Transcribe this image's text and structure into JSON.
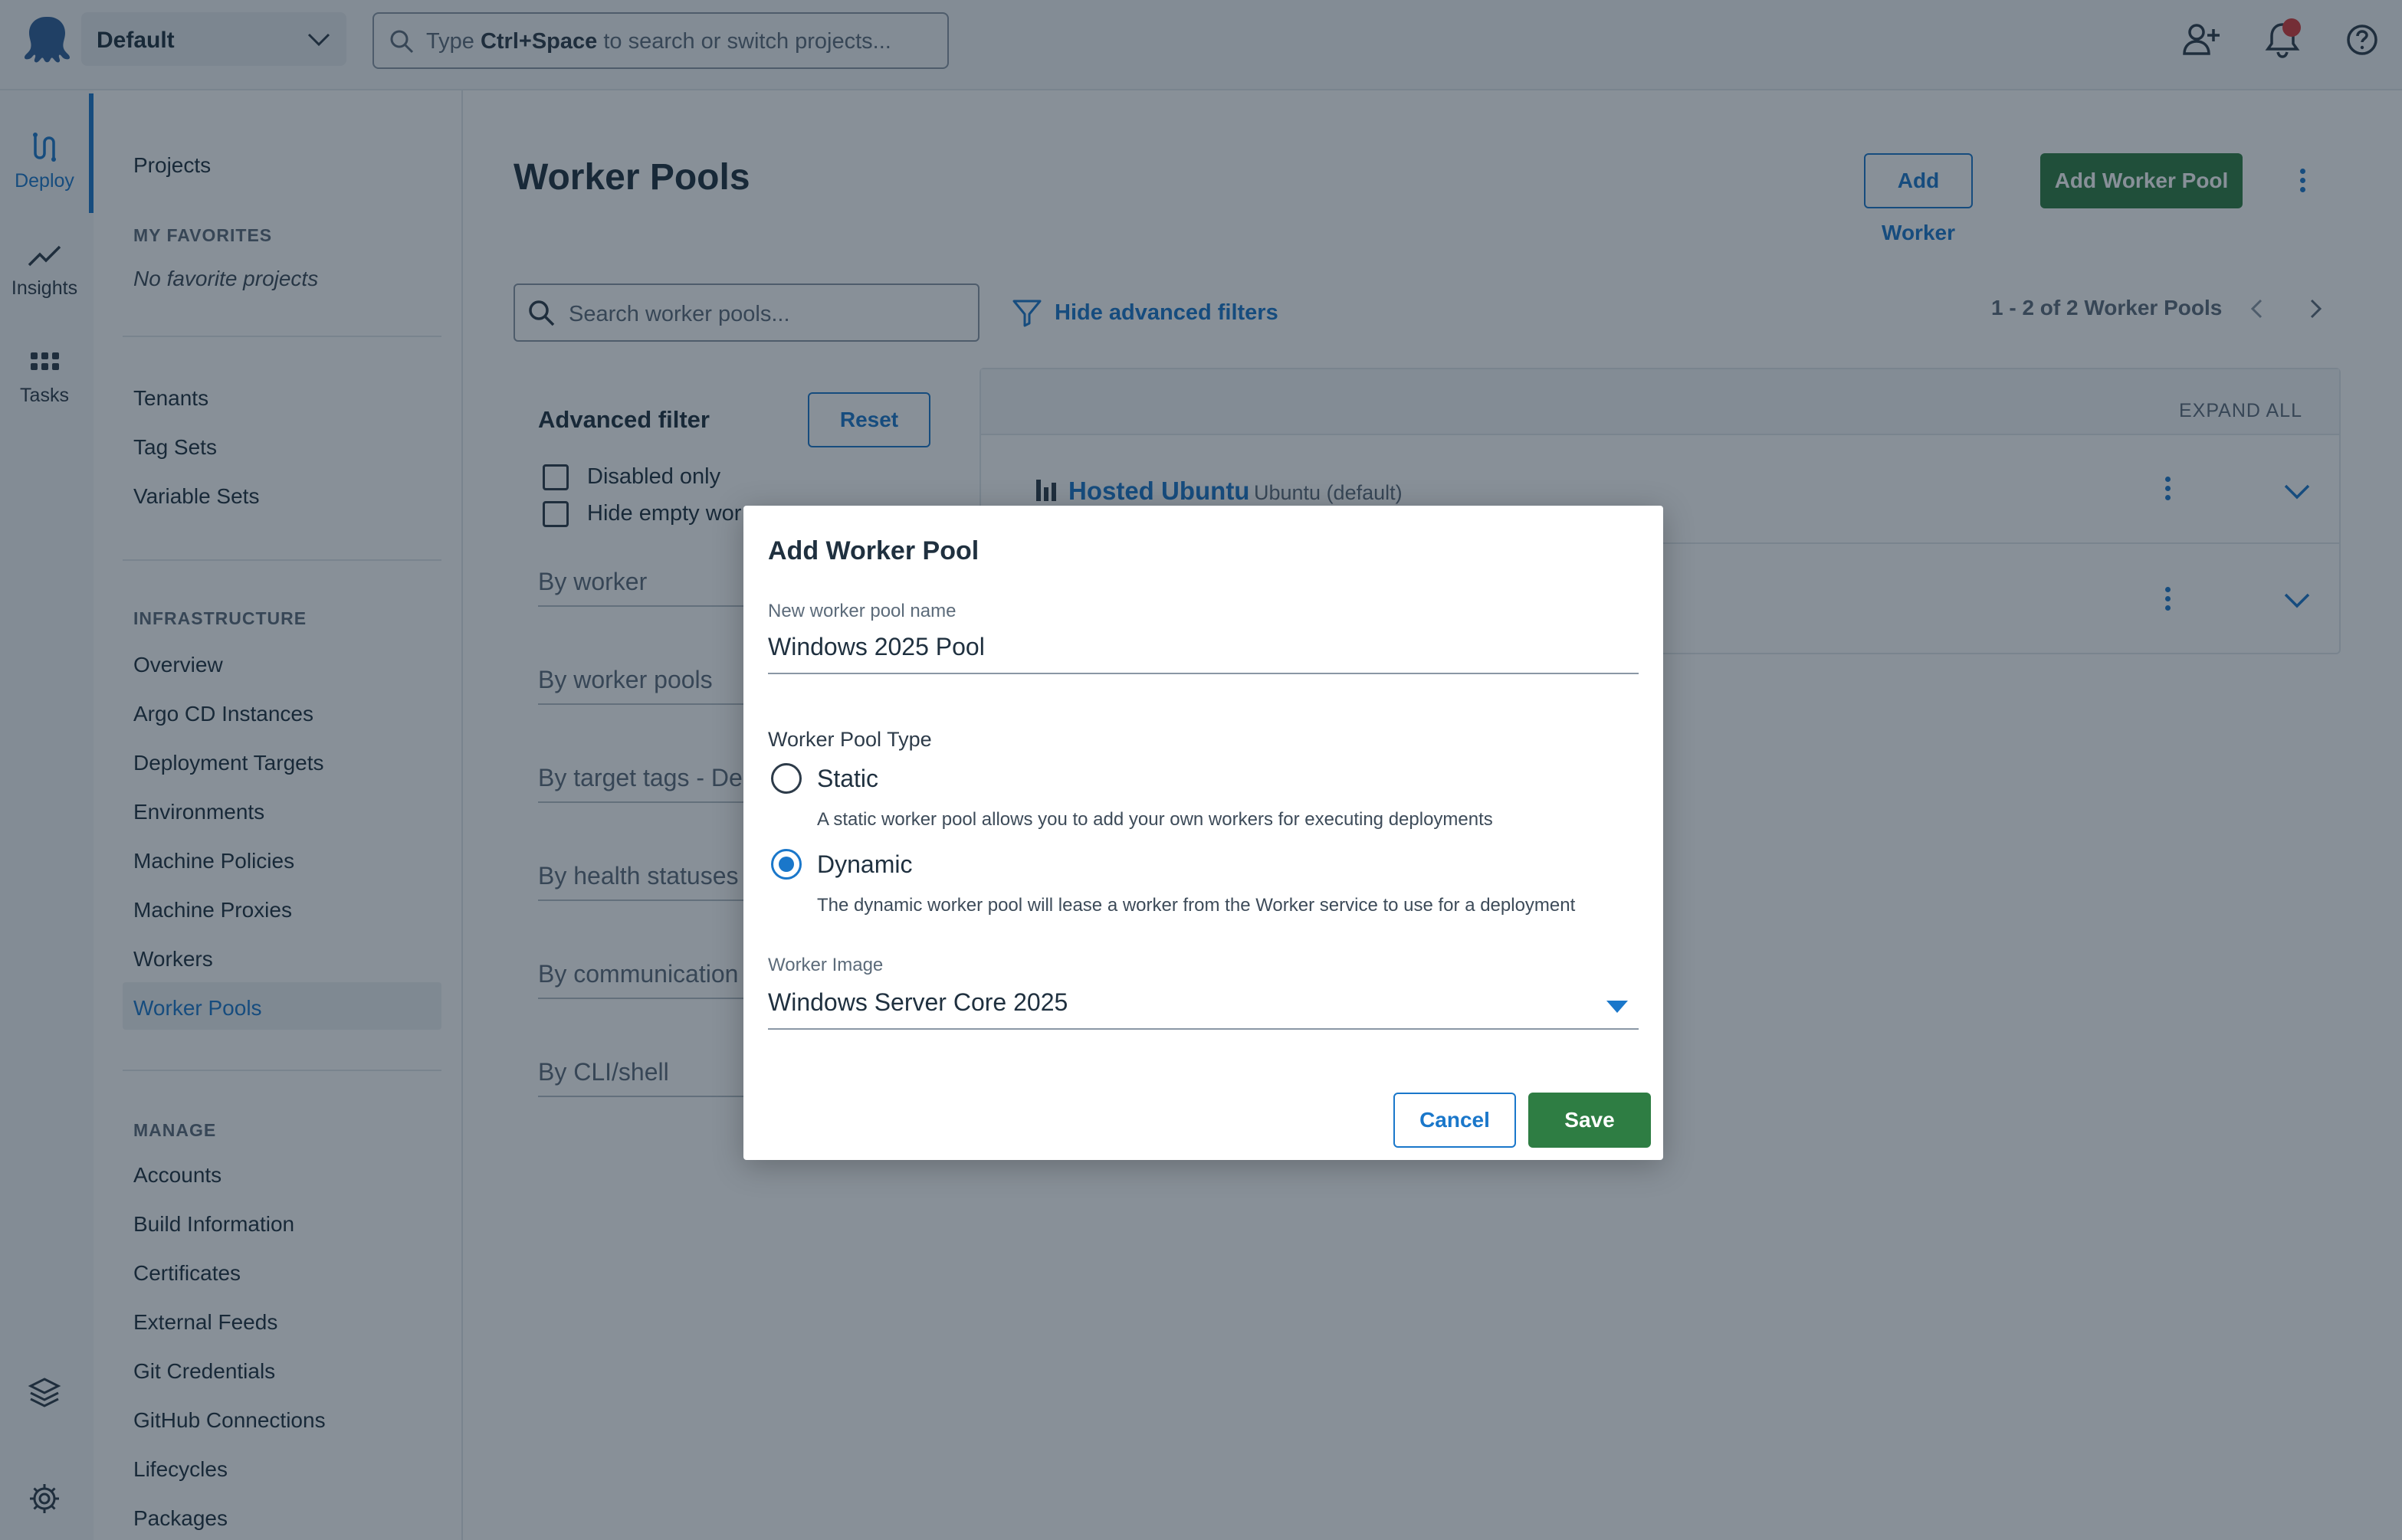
{
  "topbar": {
    "space_name": "Default",
    "search_placeholder_pre": "Type ",
    "search_placeholder_key": "Ctrl+Space",
    "search_placeholder_post": " to search or switch projects..."
  },
  "rail": {
    "items": [
      {
        "label": "Deploy",
        "icon": "deploy-icon"
      },
      {
        "label": "Insights",
        "icon": "insights-icon"
      },
      {
        "label": "Tasks",
        "icon": "tasks-icon"
      }
    ],
    "bottom_icons": [
      "layers-icon",
      "gear-icon"
    ]
  },
  "sidebar": {
    "projects": "Projects",
    "favorites_heading": "MY FAVORITES",
    "favorites_empty": "No favorite projects",
    "group1": [
      "Tenants",
      "Tag Sets",
      "Variable Sets"
    ],
    "infrastructure_heading": "INFRASTRUCTURE",
    "infrastructure": [
      "Overview",
      "Argo CD Instances",
      "Deployment Targets",
      "Environments",
      "Machine Policies",
      "Machine Proxies",
      "Workers",
      "Worker Pools"
    ],
    "manage_heading": "MANAGE",
    "manage": [
      "Accounts",
      "Build Information",
      "Certificates",
      "External Feeds",
      "Git Credentials",
      "GitHub Connections",
      "Lifecycles",
      "Packages"
    ]
  },
  "main": {
    "title": "Worker Pools",
    "add_worker": "Add Worker",
    "add_worker_pool": "Add Worker Pool",
    "search_placeholder": "Search worker pools...",
    "hide_filters": "Hide advanced filters",
    "pager": "1 - 2 of 2 Worker Pools",
    "advanced_filter": "Advanced filter",
    "reset": "Reset",
    "checkboxes": [
      "Disabled only",
      "Hide empty wor"
    ],
    "filters": [
      "By worker",
      "By worker pools",
      "By target tags - De",
      "By health statuses",
      "By communication",
      "By CLI/shell"
    ],
    "expand_all": "EXPAND ALL",
    "rows": [
      {
        "name": "Hosted Ubuntu",
        "sub": "Ubuntu (default)"
      },
      {
        "name": "",
        "sub": ""
      }
    ]
  },
  "modal": {
    "title": "Add Worker Pool",
    "name_label": "New worker pool name",
    "name_value": "Windows 2025 Pool",
    "type_label": "Worker Pool Type",
    "static_label": "Static",
    "static_desc": "A static worker pool allows you to add your own workers for executing deployments",
    "dynamic_label": "Dynamic",
    "dynamic_desc": "The dynamic worker pool will lease a worker from the Worker service to use for a deployment",
    "selected_type": "Dynamic",
    "image_label": "Worker Image",
    "image_value": "Windows Server Core 2025",
    "cancel": "Cancel",
    "save": "Save"
  },
  "colors": {
    "accent": "#1a77ca",
    "primary_button": "#2e7d43",
    "notification": "#d63b3b"
  }
}
